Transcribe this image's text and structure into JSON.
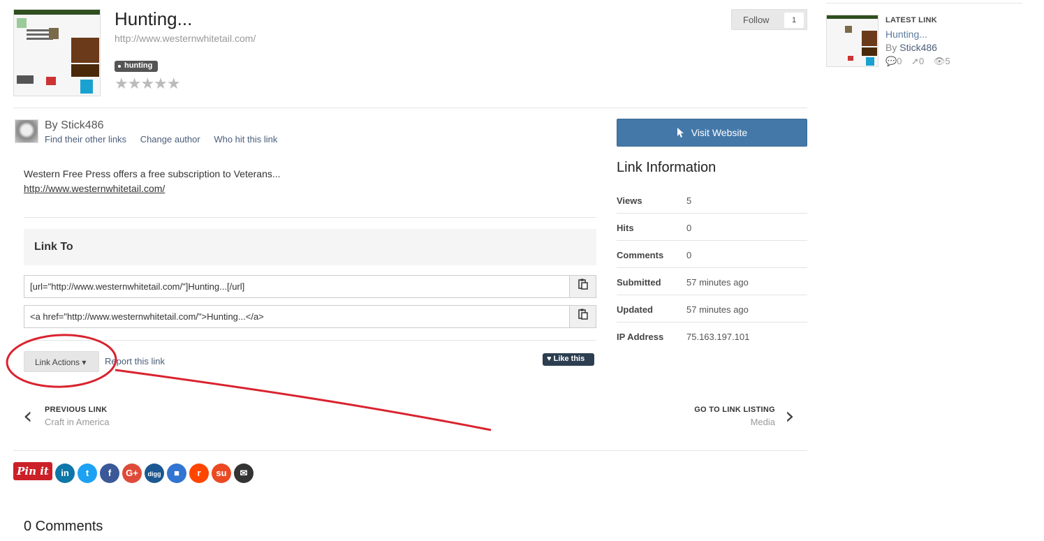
{
  "link": {
    "title": "Hunting...",
    "url": "http://www.westernwhitetail.com/",
    "tag": "hunting",
    "rating_stars": "★★★★★",
    "follow_label": "Follow",
    "follow_count": "1"
  },
  "author": {
    "by": "By Stick486",
    "links": [
      "Find their other links",
      "Change author",
      "Who hit this link"
    ]
  },
  "description": {
    "text": "Western Free Press offers a free subscription to Veterans...",
    "link": "http://www.westernwhitetail.com/"
  },
  "link_to": {
    "heading": "Link To",
    "bbcode": "[url=\"http://www.westernwhitetail.com/\"]Hunting...[/url]",
    "html": "<a href=\"http://www.westernwhitetail.com/\">Hunting...</a>",
    "copy_icon": "clipboard-icon"
  },
  "actions": {
    "link_actions": "Link Actions ▾",
    "report": "Report this link",
    "like": "Like this"
  },
  "nav": {
    "prev_label": "PREVIOUS LINK",
    "prev_title": "Craft in America",
    "next_label": "GO TO LINK LISTING",
    "next_title": "Media"
  },
  "share": {
    "pinit": "Pin it",
    "buttons": [
      {
        "name": "linkedin",
        "glyph": "in",
        "color": "#0e76a8"
      },
      {
        "name": "twitter",
        "glyph": "t",
        "color": "#1da1f2"
      },
      {
        "name": "facebook",
        "glyph": "f",
        "color": "#3b5998"
      },
      {
        "name": "google-plus",
        "glyph": "G+",
        "color": "#dd4b39"
      },
      {
        "name": "digg",
        "glyph": "digg",
        "color": "#1b5891"
      },
      {
        "name": "delicious",
        "glyph": "■",
        "color": "#3274d1"
      },
      {
        "name": "reddit",
        "glyph": "r",
        "color": "#ff4500"
      },
      {
        "name": "stumbleupon",
        "glyph": "su",
        "color": "#eb4924"
      },
      {
        "name": "email",
        "glyph": "✉",
        "color": "#333333"
      }
    ]
  },
  "comments": {
    "heading": "0 Comments"
  },
  "sidebar": {
    "visit": "Visit Website",
    "info_title": "Link Information",
    "info": [
      {
        "key": "Views",
        "value": "5"
      },
      {
        "key": "Hits",
        "value": "0"
      },
      {
        "key": "Comments",
        "value": "0"
      },
      {
        "key": "Submitted",
        "value": "57 minutes ago"
      },
      {
        "key": "Updated",
        "value": "57 minutes ago"
      },
      {
        "key": "IP Address",
        "value": "75.163.197.101"
      }
    ]
  },
  "latest": {
    "label": "LATEST LINK",
    "title": "Hunting...",
    "by_prefix": "By ",
    "author": "Stick486",
    "comments": "0",
    "hits": "0",
    "views": "5"
  },
  "colors": {
    "accent_button": "#4478a8",
    "annotation_red": "#d9232f",
    "like_bg": "#2c3e50"
  }
}
